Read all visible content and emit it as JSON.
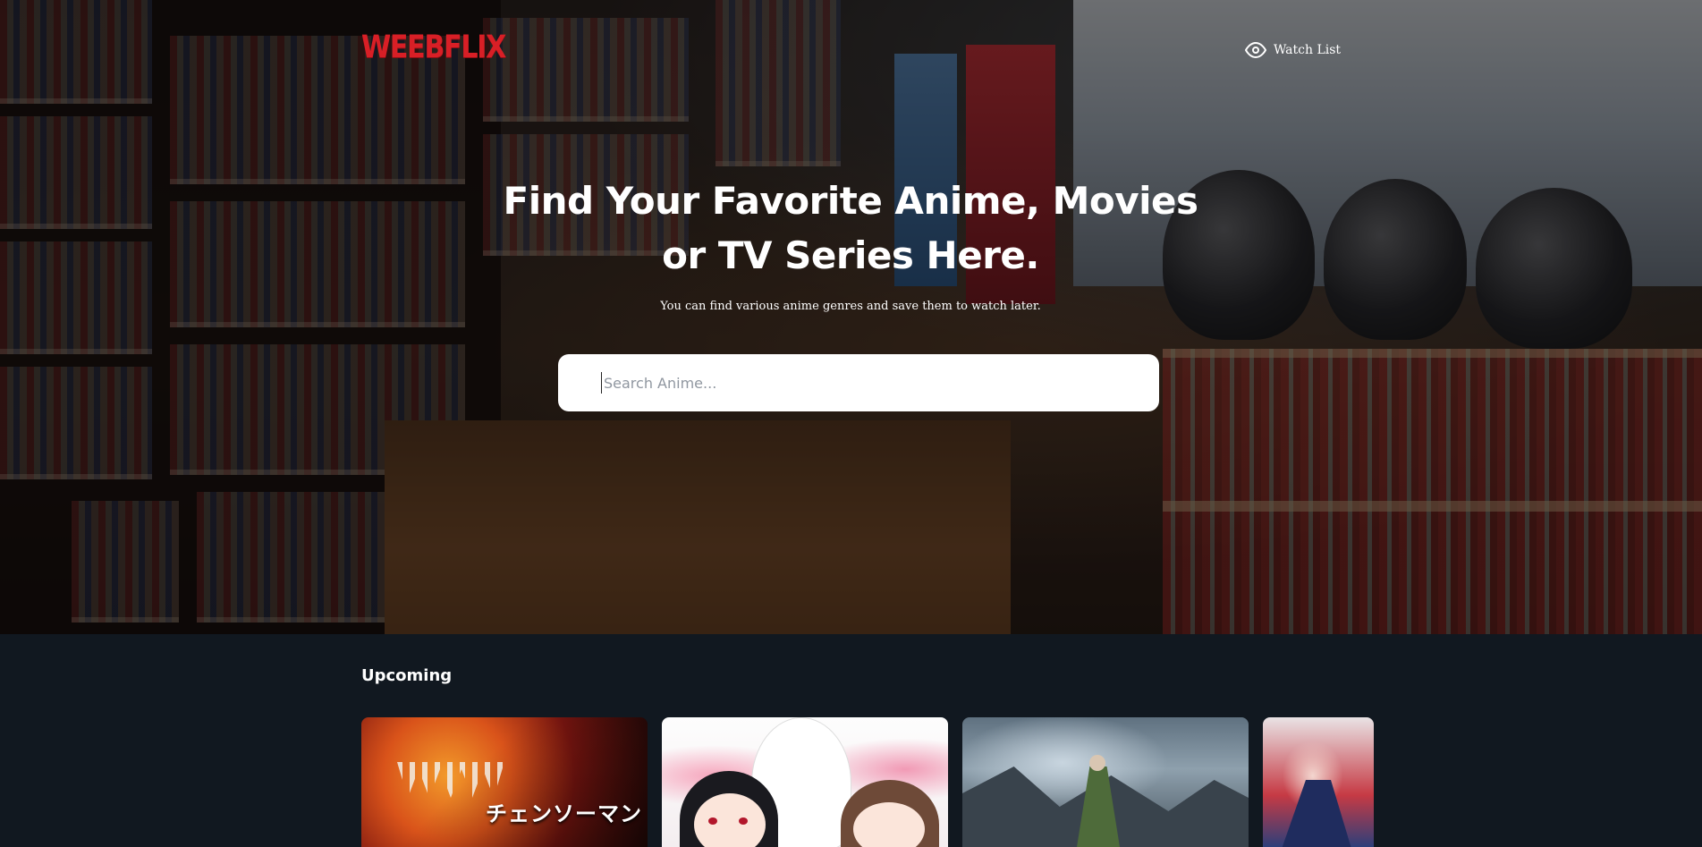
{
  "header": {
    "logo_text": "WEEBFLIX",
    "watchlist_label": "Watch List",
    "watchlist_icon": "eye-icon"
  },
  "hero": {
    "headline_line1": "Find Your Favorite Anime, Movies",
    "headline_line2": "or TV Series Here.",
    "subtitle": "You can find various anime genres and save them to watch later.",
    "search_placeholder": "Search Anime...",
    "search_value": ""
  },
  "upcoming": {
    "title": "Upcoming",
    "cards": [
      {
        "image_text": "チェンソーマン"
      },
      {
        "image_text": ""
      },
      {
        "image_text": ""
      },
      {
        "image_text": ""
      }
    ]
  },
  "colors": {
    "brand_red": "#d81f26",
    "page_background": "#111820",
    "search_background": "#ffffff",
    "text_white": "#ffffff"
  }
}
